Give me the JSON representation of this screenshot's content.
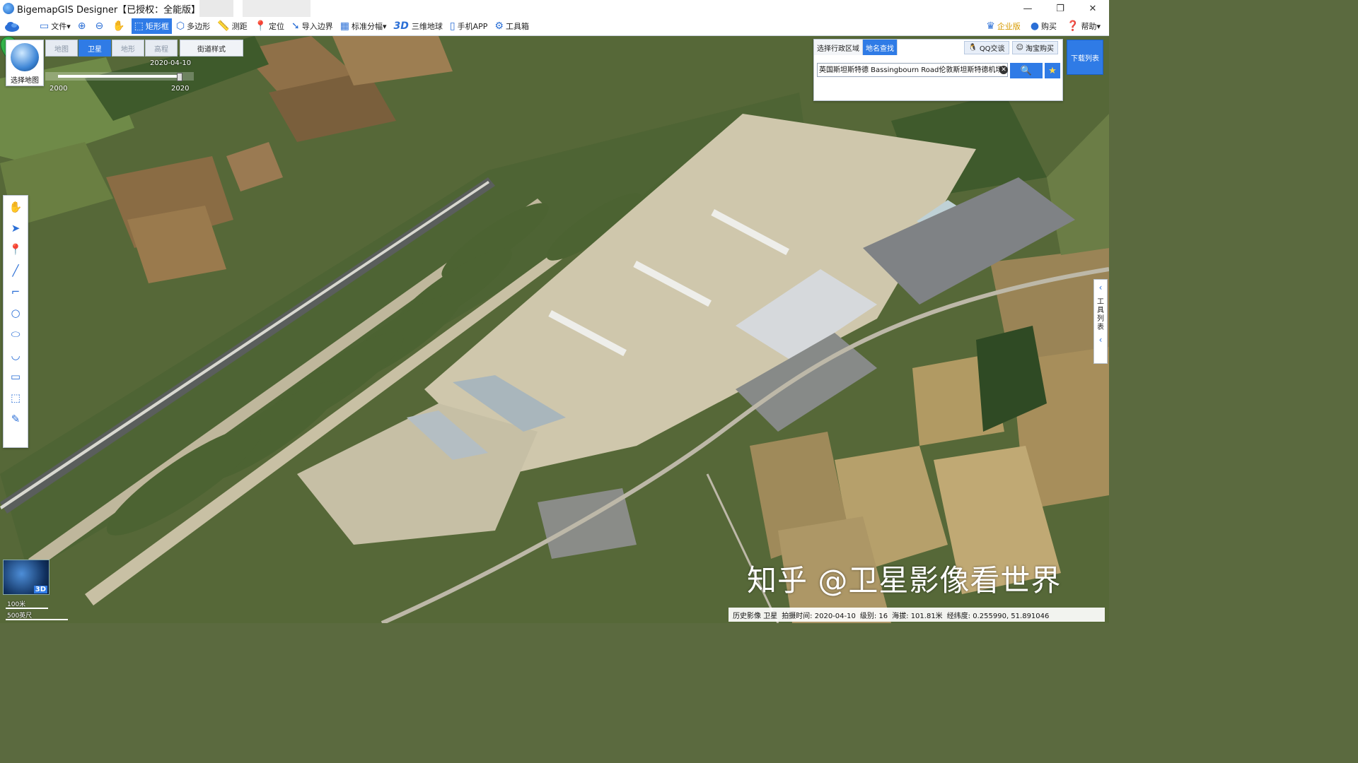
{
  "window": {
    "title": "BigemapGIS Designer【已授权：全能版】",
    "minimize": "—",
    "restore": "❐",
    "close": "✕"
  },
  "toolbar": {
    "file": "文件",
    "zoom_in_icon": "zoom-in-icon",
    "zoom_out_icon": "zoom-out-icon",
    "hand_icon": "hand-icon",
    "rect": "矩形框",
    "polygon": "多边形",
    "measure": "测距",
    "locate": "定位",
    "import_boundary": "导入边界",
    "sheet": "标准分幅",
    "three_d_mark": "3D",
    "globe": "三维地球",
    "mobile": "手机APP",
    "toolbox": "工具箱",
    "enterprise": "企业版",
    "buy": "购买",
    "help": "帮助"
  },
  "map_panel": {
    "select_map": "选择地图",
    "tabs": [
      "地图",
      "卫星",
      "地形",
      "高程"
    ],
    "active_tab": "卫星",
    "street_style": "街道样式",
    "slider": {
      "date": "2020-04-10",
      "min": "2000",
      "max": "2020",
      "value": 2020
    }
  },
  "search": {
    "tab_region": "选择行政区域",
    "tab_place": "地名查找",
    "qq": "QQ交谈",
    "taobao": "淘宝购买",
    "query": "英国斯坦斯特德 Bassingbourn Road伦敦斯坦斯特德机场"
  },
  "download_list": "下载列表",
  "tool_list": "工具列表",
  "minimap_3d": "3D",
  "scale": {
    "top": "100米",
    "bottom": "500英尺"
  },
  "status": {
    "history": "历史影像 卫星",
    "time": "拍摄时间: 2020-04-10",
    "level": "级别:  16",
    "altitude": "海拔: 101.81米",
    "lonlat": "经纬度:   0.255990, 51.891046"
  },
  "watermark": "知乎 @卫星影像看世界",
  "colors": {
    "accent": "#2f7be6",
    "map_field": "#5b6a3f"
  }
}
